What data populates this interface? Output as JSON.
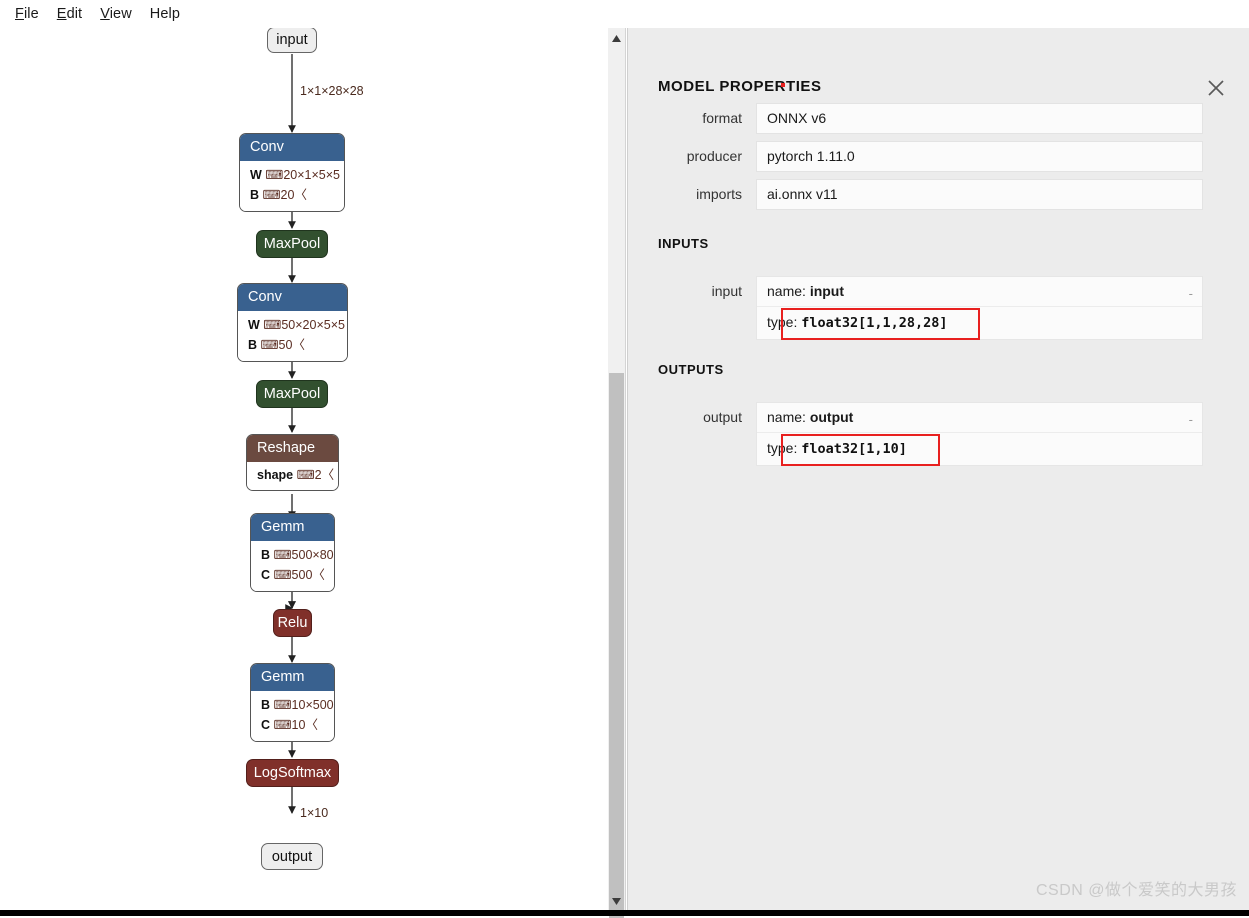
{
  "menu": {
    "items": [
      {
        "pre": "",
        "acc": "F",
        "post": "ile"
      },
      {
        "pre": "",
        "acc": "E",
        "post": "dit"
      },
      {
        "pre": "",
        "acc": "V",
        "post": "iew"
      },
      {
        "pre": "Help",
        "acc": "",
        "post": ""
      }
    ]
  },
  "toolbar": {
    "menu_icon": "hamburger-icon",
    "zoom_in_icon": "zoom-in-icon",
    "zoom_out_icon": "zoom-out-icon"
  },
  "graph": {
    "nodes": [
      {
        "id": "input",
        "kind": "io",
        "label": "input"
      },
      {
        "id": "conv1",
        "kind": "box",
        "label": "Conv",
        "attrs": [
          {
            "key": "W",
            "val": "⌨20×1×5×5〈"
          },
          {
            "key": "B",
            "val": "⌨20〈"
          }
        ]
      },
      {
        "id": "maxpool1",
        "kind": "op",
        "label": "MaxPool"
      },
      {
        "id": "conv2",
        "kind": "box",
        "label": "Conv",
        "attrs": [
          {
            "key": "W",
            "val": "⌨50×20×5×5〈"
          },
          {
            "key": "B",
            "val": "⌨50〈"
          }
        ]
      },
      {
        "id": "maxpool2",
        "kind": "op",
        "label": "MaxPool"
      },
      {
        "id": "reshape",
        "kind": "box",
        "label": "Reshape",
        "attrs": [
          {
            "key": "shape",
            "val": "⌨2〈"
          }
        ]
      },
      {
        "id": "gemm1",
        "kind": "box",
        "label": "Gemm",
        "attrs": [
          {
            "key": "B",
            "val": "⌨500×800〈"
          },
          {
            "key": "C",
            "val": "⌨500〈"
          }
        ]
      },
      {
        "id": "relu",
        "kind": "op",
        "label": "Relu"
      },
      {
        "id": "gemm2",
        "kind": "box",
        "label": "Gemm",
        "attrs": [
          {
            "key": "B",
            "val": "⌨10×500〈"
          },
          {
            "key": "C",
            "val": "⌨10〈"
          }
        ]
      },
      {
        "id": "logsoftmax",
        "kind": "op",
        "label": "LogSoftmax"
      },
      {
        "id": "output",
        "kind": "io",
        "label": "output"
      }
    ],
    "edge_labels": [
      {
        "id": "e-input",
        "text": "1×1×28×28"
      },
      {
        "id": "e-out",
        "text": "1×10"
      }
    ],
    "colors": {
      "conv": "#39618f",
      "maxpool": "#32502f",
      "reshape": "#6b4a40",
      "gemm": "#39618f",
      "relu": "#80302a",
      "logsoftmax": "#80302a",
      "io_fill": "#eeeeee"
    }
  },
  "panel": {
    "title": "MODEL PROPERTIES",
    "close_icon": "close-icon",
    "properties": [
      {
        "label": "format",
        "value": "ONNX v6"
      },
      {
        "label": "producer",
        "value": "pytorch 1.11.0"
      },
      {
        "label": "imports",
        "value": "ai.onnx v11"
      }
    ],
    "inputs_heading": "INPUTS",
    "inputs": [
      {
        "label": "input",
        "name_prefix": "name: ",
        "name_value": "input",
        "type_prefix": "type: ",
        "type_value": "float32[1,1,28,28]",
        "collapse": "-"
      }
    ],
    "outputs_heading": "OUTPUTS",
    "outputs": [
      {
        "label": "output",
        "name_prefix": "name: ",
        "name_value": "output",
        "type_prefix": "type: ",
        "type_value": "float32[1,10]",
        "collapse": "-"
      }
    ],
    "annotation_color": "#e8201f"
  },
  "watermark": {
    "text": "CSDN @做个爱笑的大男孩"
  }
}
